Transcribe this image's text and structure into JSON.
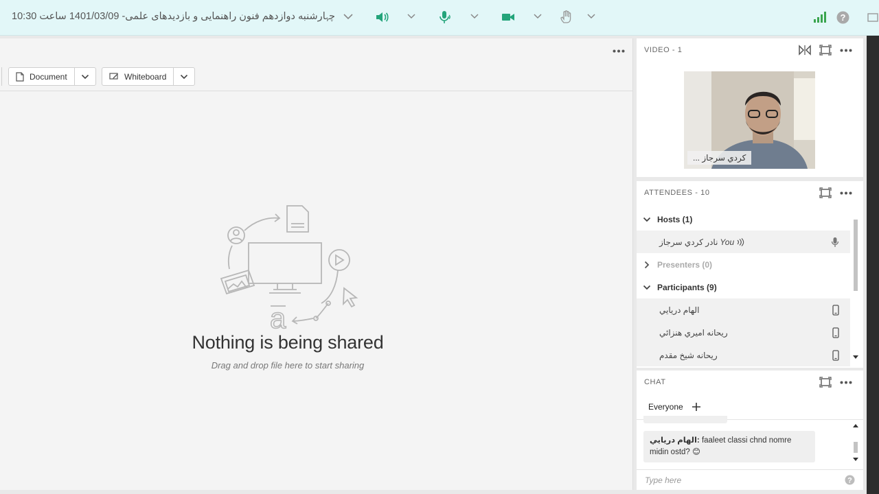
{
  "topbar": {
    "meeting_title": "ﭼﮩﺎﺭشنبه دوازدهم فنون راهنمایی و بازدیدهای علمی- 1401/03/09 ساعت 10:30",
    "colors": {
      "accent": "#23a47a",
      "signal": "#3aa54f",
      "muted": "#999999"
    }
  },
  "share": {
    "document_button": "Document",
    "whiteboard_button": "Whiteboard",
    "empty_title": "Nothing is being shared",
    "empty_hint": "Drag and drop file here to start sharing"
  },
  "video": {
    "title": "VIDEO  - 1",
    "participant_name": "كردي سرجاز ..."
  },
  "attendees": {
    "title": "ATTENDEES  - 10",
    "hosts_label": "Hosts (1)",
    "host_name": "نادر كردي سرجاز",
    "host_you": "You",
    "presenters_label": "Presenters (0)",
    "participants_label": "Participants (9)",
    "participants": [
      "الهام دريايي",
      "ريحانه اميري هنزائي",
      "ريحانه شيخ مقدم"
    ]
  },
  "chat": {
    "title": "CHAT",
    "tab_everyone": "Everyone",
    "message_sender": "الهام دريايي:",
    "message_text": " faaleet classi chnd nomre midin ostd? 😊",
    "input_placeholder": "Type here"
  }
}
